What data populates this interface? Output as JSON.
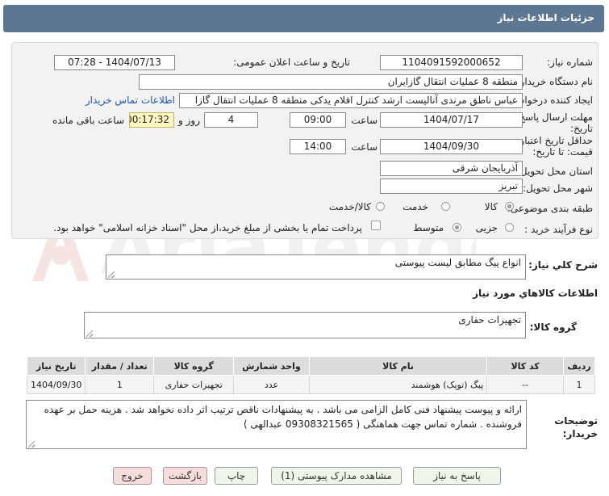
{
  "header": {
    "title": "جزئیات اطلاعات نیاز"
  },
  "form": {
    "need_number_label": "شماره نیاز:",
    "need_number": "1104091592000652",
    "announce_label": "تاریخ و ساعت اعلان عمومی:",
    "announce_value": "1404/07/13 - 07:28",
    "buyer_label": "نام دستگاه خریدار:",
    "buyer": "منطقه 8 عملیات انتقال گازایران",
    "creator_label": "ایجاد کننده درخواست:",
    "creator": "عباس ناطق مرندی آنالیست ارشد کنترل اقلام یدکی منطقه 8 عملیات انتقال گازا",
    "contact_link": "اطلاعات تماس خریدار",
    "deadline_label_1": "مهلت ارسال پاسخ: تا",
    "deadline_label_2": "تاریخ:",
    "deadline_date": "1404/07/17",
    "hour_label": "ساعت",
    "deadline_time": "09:00",
    "days_value": "4",
    "days_label": "روز و",
    "remaining_time": "00:17:32",
    "remaining_label": "ساعت باقی مانده",
    "validity_label_1": "حداقل تاریخ اعتبار",
    "validity_label_2": "قیمت: تا تاریخ:",
    "validity_date": "1404/09/30",
    "validity_hour_label": "ساعت",
    "validity_time": "14:00",
    "province_label": "استان محل تحویل:",
    "province": "آذربایجان شرقی",
    "city_label": "شهر محل تحویل:",
    "city": "تبریز",
    "category_label": "طبقه بندی موضوعی:",
    "category_options": [
      "کالا",
      "خدمت",
      "کالا/خدمت"
    ],
    "process_label": "نوع فرآیند خرید :",
    "process_options": [
      "جزیی",
      "متوسط"
    ],
    "payment_note": "پرداخت تمام یا بخشی از مبلغ خرید،از محل \"اسناد خزانه اسلامی\" خواهد بود."
  },
  "summary": {
    "label": "شرح کلي نياز:",
    "value": "انواع پیگ مطابق لیست پیوستی"
  },
  "goods_info": {
    "title": "اطلاعات کالاهاي مورد نياز",
    "group_label": "گروه کالا:",
    "group_value": "تجهیزات حفاری"
  },
  "table": {
    "headers": [
      "ردیف",
      "کد کالا",
      "نام کالا",
      "واحد شمارش",
      "گروه کالا",
      "تعداد / مقدار",
      "تاریخ نیاز"
    ],
    "rows": [
      [
        "1",
        "--",
        "پیگ (توپک) هوشمند",
        "عدد",
        "تجهیزات حفاری",
        "1",
        "1404/09/30"
      ]
    ]
  },
  "buyer_notes": {
    "label_1": "توضیحات",
    "label_2": "خریدار:",
    "line_1": "ارائه و پیوست پیشنهاد فنی کامل الزامی می باشد . به پیشنهادات ناقص ترتیب اثر داده نخواهد شد . هزینه حمل بر عهده",
    "line_2": "فروشنده . شماره تماس جهت هماهنگی ( 09308321565 عبدالهی )"
  },
  "buttons": {
    "reply": "پاسخ به نیاز",
    "attachments": "مشاهده مدارک پیوستی (1)",
    "print": "چاپ",
    "back": "بازگشت",
    "exit": "خروج"
  },
  "colors": {
    "header_bg": "#5d7793",
    "link": "#1e57a8",
    "highlight": "#fff7c2"
  }
}
